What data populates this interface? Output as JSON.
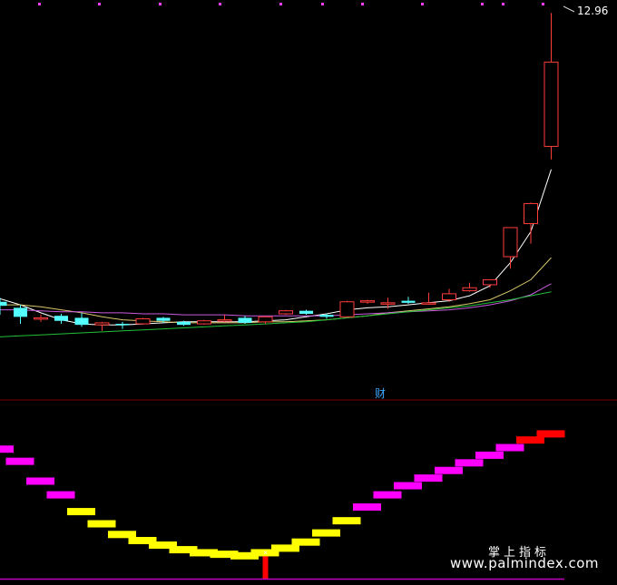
{
  "chart_data": [
    {
      "type": "candlestick",
      "panel": "price",
      "x": [
        1,
        2,
        3,
        4,
        5,
        6,
        7,
        8,
        9,
        10,
        11,
        12,
        13,
        14,
        15,
        16,
        17,
        18,
        19,
        20,
        21,
        22,
        23,
        24,
        25,
        26,
        27,
        28
      ],
      "candles": [
        {
          "open": 10.08,
          "high": 10.12,
          "low": 9.95,
          "close": 10.04
        },
        {
          "open": 10.02,
          "high": 10.05,
          "low": 9.86,
          "close": 9.93
        },
        {
          "open": 9.91,
          "high": 9.95,
          "low": 9.88,
          "close": 9.92
        },
        {
          "open": 9.94,
          "high": 9.96,
          "low": 9.86,
          "close": 9.89
        },
        {
          "open": 9.92,
          "high": 9.97,
          "low": 9.83,
          "close": 9.85
        },
        {
          "open": 9.85,
          "high": 9.88,
          "low": 9.79,
          "close": 9.87
        },
        {
          "open": 9.86,
          "high": 9.88,
          "low": 9.81,
          "close": 9.85
        },
        {
          "open": 9.86,
          "high": 9.92,
          "low": 9.85,
          "close": 9.91
        },
        {
          "open": 9.92,
          "high": 9.93,
          "low": 9.87,
          "close": 9.89
        },
        {
          "open": 9.88,
          "high": 9.89,
          "low": 9.84,
          "close": 9.85
        },
        {
          "open": 9.86,
          "high": 9.9,
          "low": 9.85,
          "close": 9.89
        },
        {
          "open": 9.89,
          "high": 9.95,
          "low": 9.88,
          "close": 9.9
        },
        {
          "open": 9.92,
          "high": 9.94,
          "low": 9.86,
          "close": 9.87
        },
        {
          "open": 9.88,
          "high": 9.94,
          "low": 9.86,
          "close": 9.93
        },
        {
          "open": 9.96,
          "high": 10.0,
          "low": 9.95,
          "close": 9.99
        },
        {
          "open": 9.99,
          "high": 10.0,
          "low": 9.95,
          "close": 9.96
        },
        {
          "open": 9.95,
          "high": 9.96,
          "low": 9.91,
          "close": 9.93
        },
        {
          "open": 9.93,
          "high": 10.09,
          "low": 9.93,
          "close": 10.08
        },
        {
          "open": 10.08,
          "high": 10.1,
          "low": 10.06,
          "close": 10.09
        },
        {
          "open": 10.06,
          "high": 10.12,
          "low": 10.01,
          "close": 10.07
        },
        {
          "open": 10.09,
          "high": 10.13,
          "low": 10.06,
          "close": 10.07
        },
        {
          "open": 10.07,
          "high": 10.17,
          "low": 10.05,
          "close": 10.07
        },
        {
          "open": 10.1,
          "high": 10.21,
          "low": 10.08,
          "close": 10.16
        },
        {
          "open": 10.19,
          "high": 10.27,
          "low": 10.18,
          "close": 10.22
        },
        {
          "open": 10.25,
          "high": 10.3,
          "low": 10.22,
          "close": 10.3
        },
        {
          "open": 10.53,
          "high": 10.63,
          "low": 10.41,
          "close": 10.82
        },
        {
          "open": 10.86,
          "high": 11.07,
          "low": 10.66,
          "close": 11.06
        },
        {
          "open": 11.63,
          "high": 12.96,
          "low": 11.5,
          "close": 12.47
        }
      ],
      "series": [
        {
          "name": "",
          "color": "#ffffff",
          "values": [
            10.11,
            10.05,
            9.97,
            9.9,
            9.86,
            9.85,
            9.85,
            9.86,
            9.87,
            9.88,
            9.88,
            9.88,
            9.88,
            9.89,
            9.9,
            9.93,
            9.96,
            10.0,
            10.02,
            10.03,
            10.05,
            10.07,
            10.09,
            10.14,
            10.24,
            10.47,
            10.78,
            11.4
          ]
        },
        {
          "name": "",
          "color": "#d8c86a",
          "values": [
            10.05,
            10.05,
            10.03,
            10.0,
            9.97,
            9.93,
            9.9,
            9.89,
            9.88,
            9.87,
            9.87,
            9.87,
            9.87,
            9.88,
            9.88,
            9.89,
            9.9,
            9.92,
            9.94,
            9.97,
            9.99,
            10.01,
            10.03,
            10.06,
            10.1,
            10.19,
            10.3,
            10.52
          ]
        },
        {
          "name": "",
          "color": "#c85adc",
          "values": [
            10.0,
            10.0,
            9.99,
            9.98,
            9.98,
            9.97,
            9.97,
            9.96,
            9.96,
            9.95,
            9.95,
            9.95,
            9.94,
            9.94,
            9.94,
            9.94,
            9.94,
            9.95,
            9.96,
            9.97,
            9.98,
            9.99,
            10.0,
            10.02,
            10.05,
            10.09,
            10.15,
            10.26
          ]
        },
        {
          "name": "",
          "color": "#22c03a",
          "values": [
            9.73,
            9.74,
            9.75,
            9.76,
            9.77,
            9.78,
            9.79,
            9.8,
            9.81,
            9.82,
            9.83,
            9.84,
            9.85,
            9.86,
            9.87,
            9.88,
            9.9,
            9.92,
            9.94,
            9.96,
            9.98,
            10.0,
            10.02,
            10.04,
            10.07,
            10.1,
            10.14,
            10.18
          ]
        }
      ],
      "last_price_label": "12.96",
      "ylim": [
        9.2,
        13.0
      ]
    },
    {
      "type": "bar",
      "panel": "indicator",
      "title": "财",
      "x": [
        1,
        2,
        3,
        4,
        5,
        6,
        7,
        8,
        9,
        10,
        11,
        12,
        13,
        14,
        15,
        16,
        17,
        18,
        19,
        20,
        21,
        22,
        23,
        24,
        25,
        26,
        27,
        28
      ],
      "levels": [
        85,
        77,
        64,
        55,
        44,
        36,
        29,
        25,
        22,
        19,
        17,
        16,
        15,
        17,
        20,
        24,
        30,
        38,
        47,
        55,
        61,
        66,
        71,
        76,
        81,
        86,
        91,
        95
      ],
      "colors": [
        "#ff00ff",
        "#ff00ff",
        "#ff00ff",
        "#ff00ff",
        "#ffff00",
        "#ffff00",
        "#ffff00",
        "#ffff00",
        "#ffff00",
        "#ffff00",
        "#ffff00",
        "#ffff00",
        "#ffff00",
        "#ffff00",
        "#ffff00",
        "#ffff00",
        "#ffff00",
        "#ffff00",
        "#ff00ff",
        "#ff00ff",
        "#ff00ff",
        "#ff00ff",
        "#ff00ff",
        "#ff00ff",
        "#ff00ff",
        "#ff00ff",
        "#ff0000",
        "#ff0000"
      ],
      "signal_at_x": 14,
      "signal_color": "#ff0000",
      "ylim": [
        0,
        100
      ]
    }
  ],
  "watermark": {
    "line1": "掌上指标",
    "line2": "www.palmindex.com"
  },
  "colors": {
    "background": "#000000",
    "up": "#ff3c3c",
    "down": "#54ffff",
    "panel_divider": "#7a0000",
    "baseline": "#c000c0",
    "title": "#3aa8ff"
  }
}
